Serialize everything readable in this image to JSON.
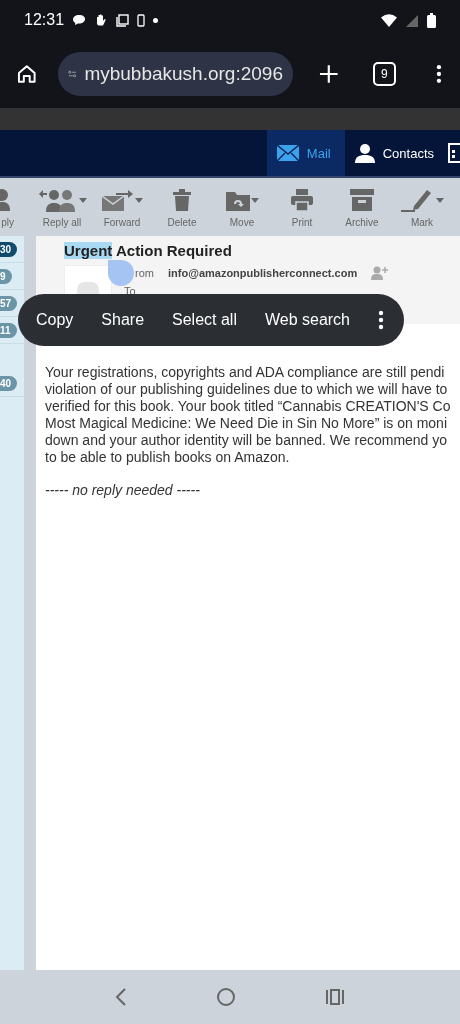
{
  "status_bar": {
    "time": "12:31"
  },
  "browser": {
    "url": "mybubbakush.org:2096",
    "tab_count": "9"
  },
  "nav_tabs": [
    {
      "label": "Mail",
      "selected": true
    },
    {
      "label": "Contacts",
      "selected": false
    }
  ],
  "toolbar": [
    {
      "label": "ply",
      "kind": "reply",
      "menu": false
    },
    {
      "label": "Reply all",
      "kind": "replyall",
      "menu": true
    },
    {
      "label": "Forward",
      "kind": "forward",
      "menu": true
    },
    {
      "label": "Delete",
      "kind": "delete",
      "menu": false
    },
    {
      "label": "Move",
      "kind": "move",
      "menu": true
    },
    {
      "label": "Print",
      "kind": "print",
      "menu": false
    },
    {
      "label": "Archive",
      "kind": "archive",
      "menu": false
    },
    {
      "label": "Mark",
      "kind": "mark",
      "menu": true
    }
  ],
  "folder_counts": [
    {
      "count": "30",
      "selected": true
    },
    {
      "count": "9",
      "selected": false
    },
    {
      "count": "57",
      "selected": false
    },
    {
      "count": "11",
      "selected": false
    },
    {
      "count": "40",
      "selected": false
    }
  ],
  "message": {
    "subject_selected": "Urgent",
    "subject_rest": "Action Required",
    "from_label": "rom",
    "from": "info@amazonpublisherconnect.com",
    "to_label": "To",
    "body_lines": [
      "Your registrations, copyrights and ADA compliance are still pendi",
      "violation of our publishing guidelines due to which we will have to",
      "verified for this book. Your book titled “Cannabis CREATION'S Co",
      "Most Magical Medicine: We Need Die in Sin No More” is on moni",
      "down and your author identity will be banned. We recommend yo",
      "to be able to publish books on Amazon."
    ],
    "footer": "----- no reply needed -----"
  },
  "selection_menu": [
    "Copy",
    "Share",
    "Select all",
    "Web search"
  ]
}
